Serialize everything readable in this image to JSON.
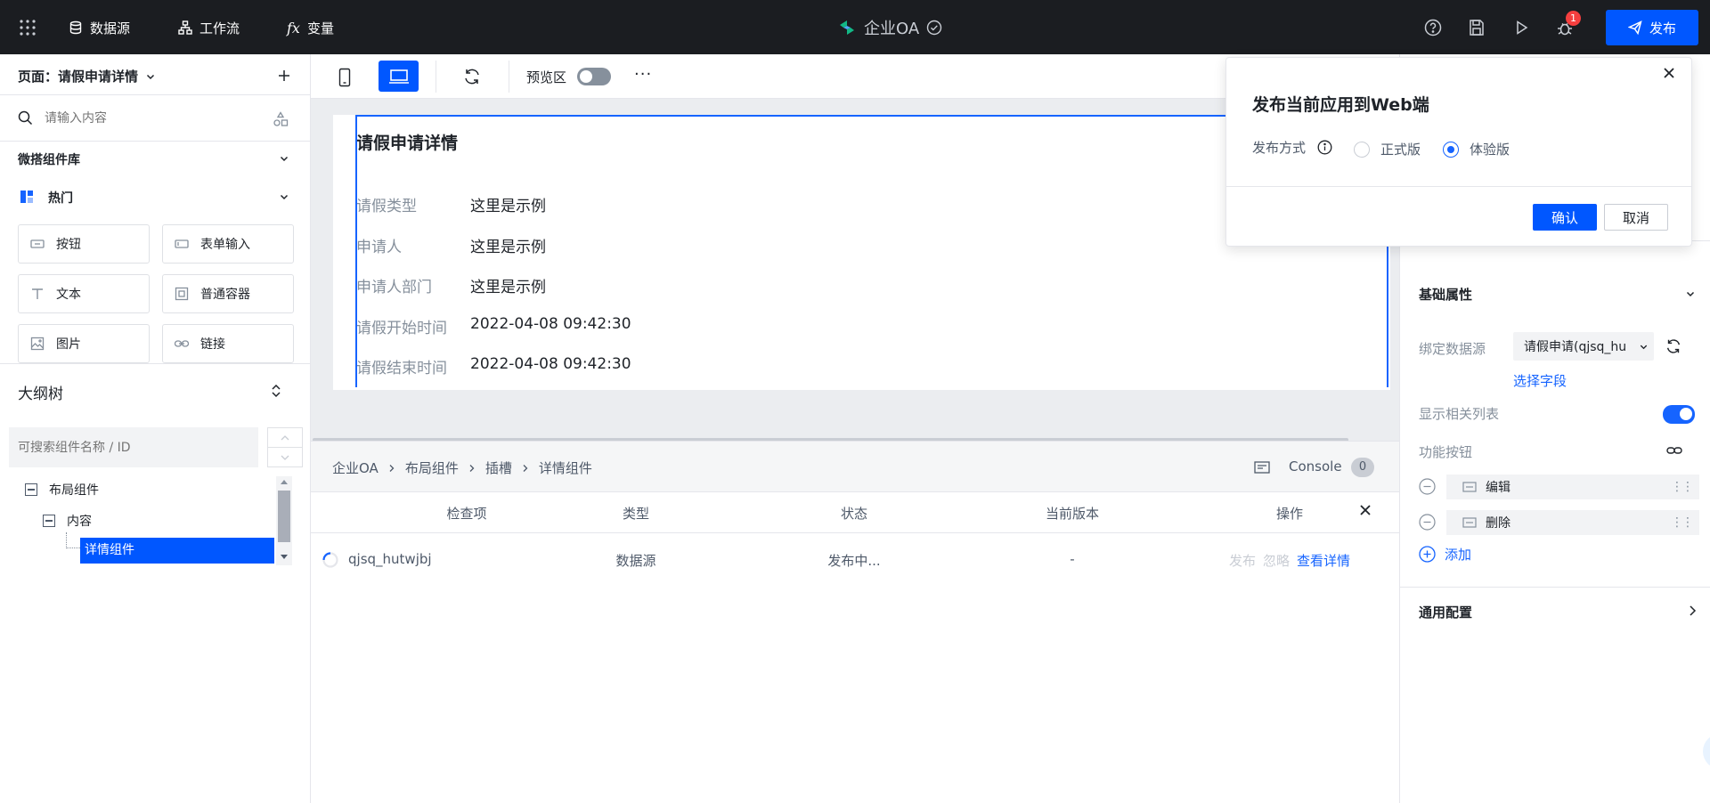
{
  "topbar": {
    "nav": [
      {
        "label": "数据源",
        "icon": "database-icon"
      },
      {
        "label": "工作流",
        "icon": "workflow-icon"
      },
      {
        "label": "变量",
        "icon": "function-icon"
      }
    ],
    "app_name": "企业OA",
    "notification_count": "1",
    "publish_label": "发布"
  },
  "left": {
    "page_label": "页面：请假申请详情",
    "search_placeholder": "请输入内容",
    "library_title": "微搭组件库",
    "hot_title": "热门",
    "components": [
      {
        "label": "按钮",
        "icon": "button-component-icon"
      },
      {
        "label": "表单输入",
        "icon": "form-input-icon"
      },
      {
        "label": "文本",
        "icon": "text-component-icon"
      },
      {
        "label": "普通容器",
        "icon": "container-icon"
      },
      {
        "label": "图片",
        "icon": "image-component-icon"
      },
      {
        "label": "链接",
        "icon": "link-component-icon"
      }
    ],
    "outline_title": "大纲树",
    "outline_search_placeholder": "可搜索组件名称 / ID",
    "tree": [
      {
        "label": "布局组件"
      },
      {
        "label": "内容"
      },
      {
        "label": "详情组件"
      }
    ]
  },
  "toolbar": {
    "preview_label": "预览区"
  },
  "card": {
    "title": "请假申请详情",
    "rows": [
      {
        "label": "请假类型",
        "value": "这里是示例"
      },
      {
        "label": "申请人",
        "value": "这里是示例"
      },
      {
        "label": "申请人部门",
        "value": "这里是示例"
      },
      {
        "label": "请假开始时间",
        "value": "2022-04-08 09:42:30"
      },
      {
        "label": "请假结束时间",
        "value": "2022-04-08 09:42:30"
      }
    ]
  },
  "bottom": {
    "breadcrumb": [
      "企业OA",
      "布局组件",
      "插槽",
      "详情组件"
    ],
    "console_label": "Console",
    "console_count": "0",
    "columns": [
      "检查项",
      "类型",
      "状态",
      "当前版本",
      "操作"
    ],
    "rows": [
      {
        "item": "qjsq_hutwjbj",
        "type": "数据源",
        "status": "发布中...",
        "version": "-",
        "actions": [
          "发布",
          "忽略",
          "查看详情"
        ]
      }
    ]
  },
  "right": {
    "basic_title": "基础属性",
    "bind_label": "绑定数据源",
    "bind_value": "请假申请(qjsq_hu",
    "choose_field": "选择字段",
    "show_related_label": "显示相关列表",
    "show_related": true,
    "func_buttons_label": "功能按钮",
    "func_buttons": [
      {
        "label": "编辑"
      },
      {
        "label": "删除"
      }
    ],
    "add_label": "添加",
    "general_title": "通用配置"
  },
  "modal": {
    "title": "发布当前应用到Web端",
    "method_label": "发布方式",
    "options": [
      {
        "label": "正式版",
        "selected": false
      },
      {
        "label": "体验版",
        "selected": true
      }
    ],
    "confirm_label": "确认",
    "cancel_label": "取消"
  },
  "colors": {
    "primary": "#0057ff",
    "accent": "#1664ff",
    "topbar_bg": "#1b1d21",
    "badge": "#f53f3f"
  }
}
